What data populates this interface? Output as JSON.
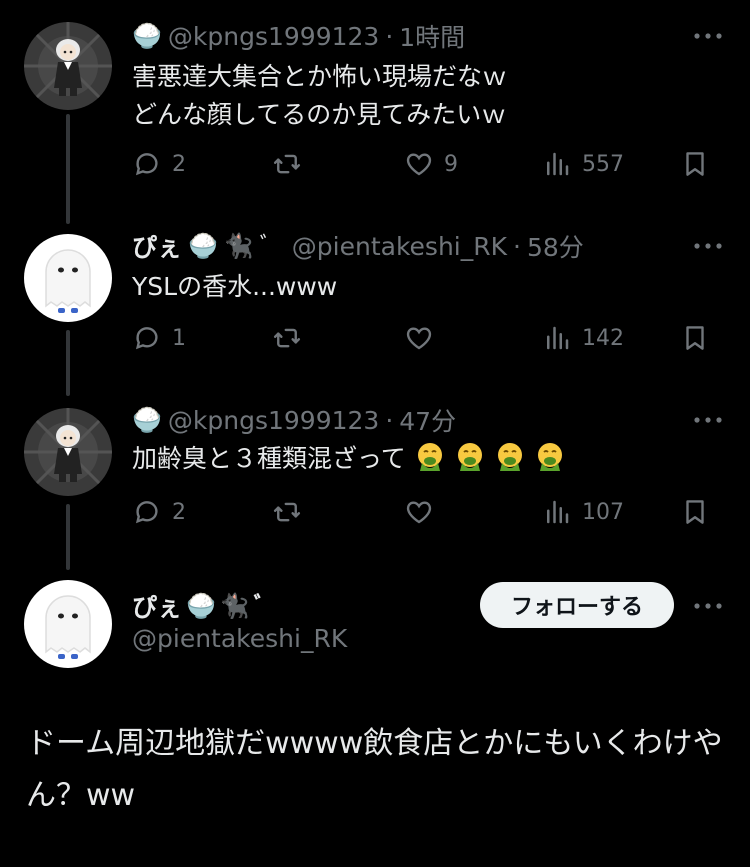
{
  "tweets": [
    {
      "display_name": "",
      "handle": "@kpngs1999123",
      "time": "1時間",
      "badges": [
        "🍚"
      ],
      "text_lines": [
        "害悪達大集合とか怖い現場だなｗ",
        "どんな顔してるのか見てみたいｗ"
      ],
      "reply_count": "2",
      "retweet_count": "",
      "like_count": "9",
      "view_count": "557"
    },
    {
      "display_name": "ぴぇ",
      "handle": "@pientakeshi_RK",
      "time": "58分",
      "badges": [
        "🍚",
        "🐈‍⬛",
        "ﾞ"
      ],
      "text_lines": [
        "YSLの香水...www"
      ],
      "reply_count": "1",
      "retweet_count": "",
      "like_count": "",
      "view_count": "142"
    },
    {
      "display_name": "",
      "handle": "@kpngs1999123",
      "time": "47分",
      "badges": [
        "🍚"
      ],
      "text_lines": [
        "加齢臭と３種類混ざって"
      ],
      "emojis": [
        "🤮",
        "🤮",
        "🤮",
        "🤮"
      ],
      "reply_count": "2",
      "retweet_count": "",
      "like_count": "",
      "view_count": "107"
    }
  ],
  "main_tweet": {
    "display_name": "ぴぇ",
    "badges": [
      "🍚",
      "🐈‍⬛",
      "ﾞ"
    ],
    "handle": "@pientakeshi_RK",
    "follow_label": "フォローする",
    "text": "ドーム周辺地獄だwwww飲食店とかにもいくわけやん？ww"
  },
  "separator": "·",
  "colors": {
    "background": "#000000",
    "text": "#e7e9ea",
    "muted": "#71767b",
    "thread_line": "#333639",
    "follow_bg": "#eff3f4"
  },
  "icons": [
    "reply-icon",
    "retweet-icon",
    "like-icon",
    "views-icon",
    "bookmark-icon",
    "more-icon"
  ]
}
